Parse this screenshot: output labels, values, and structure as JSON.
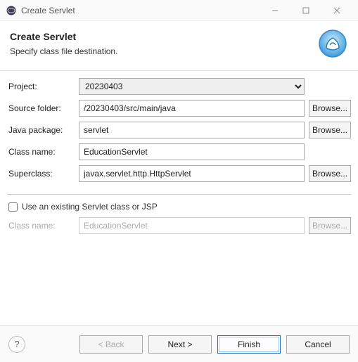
{
  "window": {
    "title": "Create Servlet"
  },
  "banner": {
    "title": "Create Servlet",
    "subtitle": "Specify class file destination."
  },
  "form": {
    "project_label": "Project:",
    "project_value": "20230403",
    "source_folder_label": "Source folder:",
    "source_folder_value": "/20230403/src/main/java",
    "java_package_label": "Java package:",
    "java_package_value": "servlet",
    "class_name_label": "Class name:",
    "class_name_value": "EducationServlet",
    "superclass_label": "Superclass:",
    "superclass_value": "javax.servlet.http.HttpServlet",
    "browse_label": "Browse...",
    "use_existing_label": "Use an existing Servlet class or JSP",
    "class_name2_label": "Class name:",
    "class_name2_value": "EducationServlet"
  },
  "footer": {
    "back_label": "< Back",
    "next_label": "Next >",
    "finish_label": "Finish",
    "cancel_label": "Cancel",
    "help_label": "?"
  }
}
